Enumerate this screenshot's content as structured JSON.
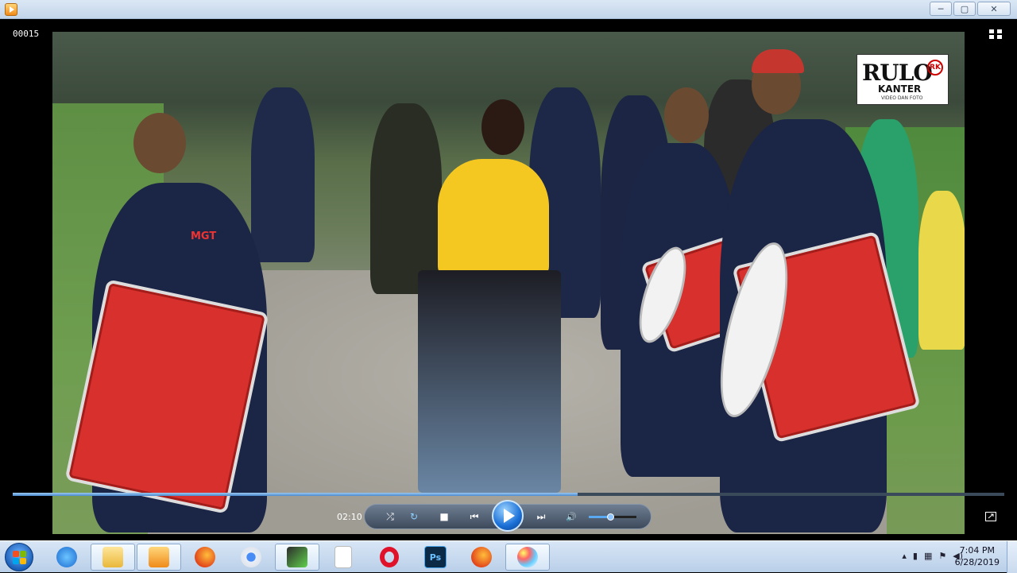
{
  "window": {
    "title": "",
    "buttons": {
      "minimize": "─",
      "maximize": "▢",
      "close": "✕"
    }
  },
  "player": {
    "frame_counter": "00015",
    "elapsed_time": "02:10",
    "progress": 0.57,
    "volume": 0.45,
    "controls": {
      "shuffle": "⤮",
      "repeat": "↻",
      "stop": "■",
      "previous": "⏮",
      "next": "⏭",
      "mute": "🔊"
    }
  },
  "video": {
    "watermark": {
      "main": "RULO",
      "badge": "RK",
      "sub": "KANTER",
      "tag": "VIDEO DAN FOTO"
    },
    "shirt_text": "MGT"
  },
  "taskbar": {
    "items": [
      {
        "name": "internet-explorer",
        "active": false
      },
      {
        "name": "file-explorer",
        "active": true
      },
      {
        "name": "media-player",
        "active": true
      },
      {
        "name": "firefox",
        "active": false
      },
      {
        "name": "chrome",
        "active": false
      },
      {
        "name": "camtasia",
        "active": true
      },
      {
        "name": "document",
        "active": false
      },
      {
        "name": "opera",
        "active": false
      },
      {
        "name": "photoshop",
        "active": false
      },
      {
        "name": "firefox-2",
        "active": false
      },
      {
        "name": "paint",
        "active": true
      }
    ],
    "clock_time": "7:04 PM",
    "clock_date": "6/28/2019"
  }
}
